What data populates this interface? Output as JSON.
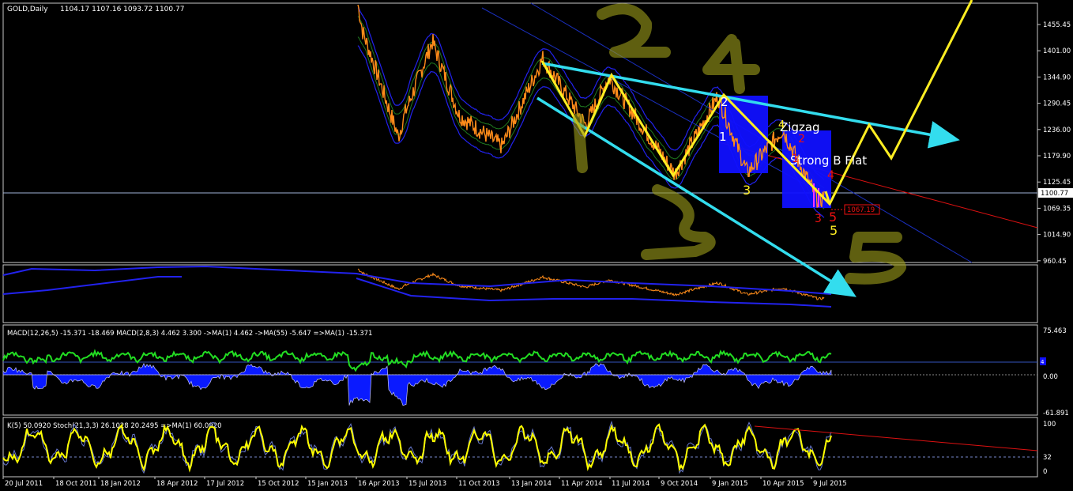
{
  "window_title": "GOLD,Daily",
  "ohlc_readout": "1104.17 1107.16 1093.72 1100.77",
  "colors": {
    "background": "#000000",
    "frame": "#c8c8c8",
    "price": "#ff8c1a",
    "band_blue": "#2222ee",
    "band_green": "#1f7a1f",
    "trend_cyan": "#33ddee",
    "wave_yellow": "#ffee22",
    "macd_hist": "#0a1aff",
    "macd_signal": "#22dd22",
    "stoch": "#ffff00",
    "red_line": "#dd1111",
    "box_blue": "#1010ff"
  },
  "chart_data": {
    "type": "line",
    "title": "GOLD,Daily",
    "ylim": [
      940,
      1520
    ],
    "price_ticks": [
      "1455.45",
      "1401.00",
      "1344.90",
      "1290.45",
      "1236.00",
      "1179.90",
      "1125.45",
      "1069.35",
      "1014.90",
      "960.45"
    ],
    "current_price": "1100.77",
    "low_label": "1067.19",
    "x_tick_labels": [
      "20 Jul 2011",
      "18 Oct 2011",
      "18 Jan 2012",
      "18 Apr 2012",
      "17 Jul 2012",
      "15 Oct 2012",
      "15 Jan 2013",
      "16 Apr 2013",
      "15 Jul 2013",
      "11 Oct 2013",
      "13 Jan 2014",
      "11 Apr 2014",
      "11 Jul 2014",
      "9 Oct 2014",
      "9 Jan 2015",
      "10 Apr 2015",
      "9 Jul 2015"
    ],
    "price_path": [
      [
        "16 Apr 2013",
        1500
      ],
      [
        "25 Apr 2013",
        1440
      ],
      [
        "10 May 2013",
        1390
      ],
      [
        "28 Jun 2013",
        1220
      ],
      [
        "10 Jul 2013",
        1270
      ],
      [
        "28 Aug 2013",
        1420
      ],
      [
        "15 Oct 2013",
        1265
      ],
      [
        "31 Dec 2013",
        1200
      ],
      [
        "14 Mar 2014",
        1385
      ],
      [
        "30 May 2014",
        1245
      ],
      [
        "10 Jul 2014",
        1345
      ],
      [
        "6 Nov 2014",
        1142
      ],
      [
        "22 Jan 2015",
        1305
      ],
      [
        "16 Mar 2015",
        1145
      ],
      [
        "18 May 2015",
        1235
      ],
      [
        "24 Jul 2015",
        1080
      ],
      [
        "31 Jul 2015",
        1100
      ]
    ],
    "macd_label": "MACD(12,26,5) -15.371 -18.469  MACD(2,8,3) 4.462 3.300  ->MA(1) 4.462  ->MA(55) -5.647  =>MA(1) -15.371",
    "macd_ticks": [
      "75.463",
      "0.00",
      "-61.891"
    ],
    "macd_marker": "4",
    "stoch_label": "K(5) 50.0920  Stoch(21,3,3) 26.1028 20.2495  =>MA(1) 60.0920",
    "stoch_ticks": [
      "100",
      "32",
      "0"
    ],
    "annotations": {
      "zigzag": "Zigzag",
      "flat": "Strong B Flat",
      "white_wave_1": "1",
      "white_wave_2": "2",
      "yellow_wave_3": "3",
      "yellow_wave_5": "5",
      "yellow_wave_4": "4",
      "red_wave_1": "1",
      "red_wave_2": "2",
      "red_wave_3": "3",
      "red_wave_4": "4",
      "red_wave_5": "5",
      "big_olive_2": "2",
      "big_olive_4": "4",
      "big_olive_3": "3",
      "big_olive_5": "5"
    }
  }
}
